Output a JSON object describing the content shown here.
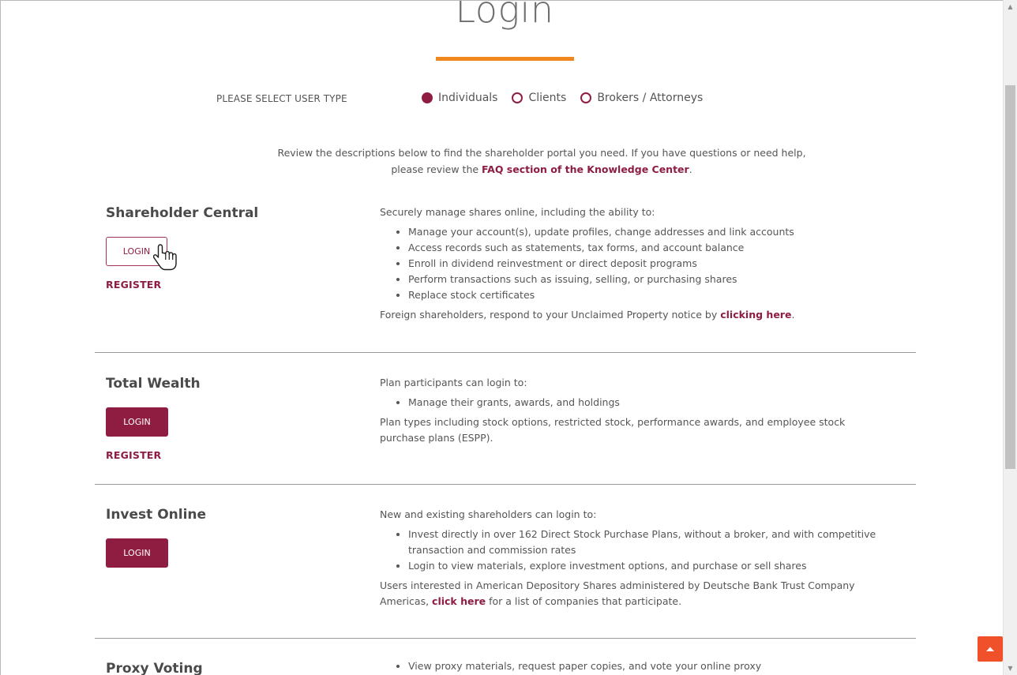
{
  "page": {
    "title": "Login",
    "accent_color": "#8e1d41",
    "title_bar_color": "#f0861e"
  },
  "user_type": {
    "label": "PLEASE SELECT USER TYPE",
    "options": [
      "Individuals",
      "Clients",
      "Brokers / Attorneys"
    ],
    "selected": "Individuals"
  },
  "intro": {
    "text_before": "Review the descriptions below to find the shareholder portal you need. If you have questions or need help, please review the ",
    "link_text": "FAQ section of the Knowledge Center",
    "text_after": "."
  },
  "sections": {
    "shareholder_central": {
      "title": "Shareholder Central",
      "login_label": "LOGIN",
      "register_label": "REGISTER",
      "intro": "Securely manage shares online, including the ability to:",
      "bullets": [
        "Manage your account(s), update profiles, change addresses and link accounts",
        "Access records such as statements, tax forms, and account balance",
        "Enroll in dividend reinvestment or direct deposit programs",
        "Perform transactions such as issuing, selling, or purchasing shares",
        "Replace stock certificates"
      ],
      "footer_before": "Foreign shareholders, respond to your Unclaimed Property notice by ",
      "footer_link": "clicking here",
      "footer_after": "."
    },
    "total_wealth": {
      "title": "Total Wealth",
      "login_label": "LOGIN",
      "register_label": "REGISTER",
      "intro": "Plan participants can login to:",
      "bullets": [
        "Manage their grants, awards, and holdings"
      ],
      "footer": "Plan types including stock options, restricted stock, performance awards, and employee stock purchase plans (ESPP)."
    },
    "invest_online": {
      "title": "Invest Online",
      "login_label": "LOGIN",
      "intro": "New and existing shareholders can login to:",
      "bullets": [
        "Invest directly in over 162 Direct Stock Purchase Plans, without a broker, and with competitive transaction and commission rates",
        "Login to view materials, explore investment options, and purchase or sell shares"
      ],
      "footer_before": "Users interested in American Depository Shares administered by Deutsche Bank Trust Company Americas, ",
      "footer_link": "click here",
      "footer_after": " for a list of companies that participate."
    },
    "proxy_voting": {
      "title": "Proxy Voting",
      "bullets": [
        "View proxy materials, request paper copies, and vote your online proxy"
      ]
    }
  },
  "icons": {
    "cursor": "hand-pointer-icon",
    "back_to_top": "caret-up-icon",
    "scroll_up": "scroll-up-arrow-icon",
    "scroll_down": "scroll-down-arrow-icon"
  }
}
